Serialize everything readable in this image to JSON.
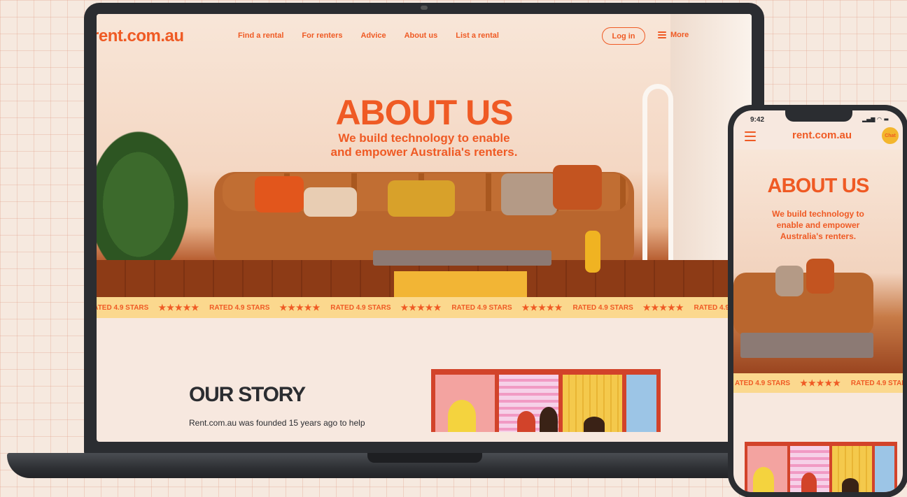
{
  "laptop": {
    "logo": "rent.com.au",
    "nav": [
      "Find a rental",
      "For renters",
      "Advice",
      "About us",
      "List a rental"
    ],
    "login_label": "Log in",
    "more_label": "More",
    "hero": {
      "title": "ABOUT US",
      "subtitle": "We build technology to enable\nand empower Australia's renters."
    },
    "marquee": {
      "label": "RATED 4.9 STARS",
      "stars": "★★★★★"
    },
    "story": {
      "title": "OUR STORY",
      "text": "Rent.com.au was founded 15 years ago to help"
    }
  },
  "phone": {
    "time": "9:42",
    "status_icons": "▂▄▆ ◠ ▬",
    "logo": "rent.com.au",
    "chat_label": "Chat",
    "hero": {
      "title": "ABOUT US",
      "subtitle": "We build technology to\nenable and empower\nAustralia's renters."
    },
    "marquee": {
      "label_partial": "ATED 4.9 STARS",
      "label": "RATED 4.9 STARS",
      "stars": "★★★★★"
    }
  },
  "colors": {
    "brand_orange": "#ef5a24",
    "marquee_yellow": "#fbd88e",
    "dark": "#2b2d31",
    "page_bg": "#f6e9df"
  }
}
